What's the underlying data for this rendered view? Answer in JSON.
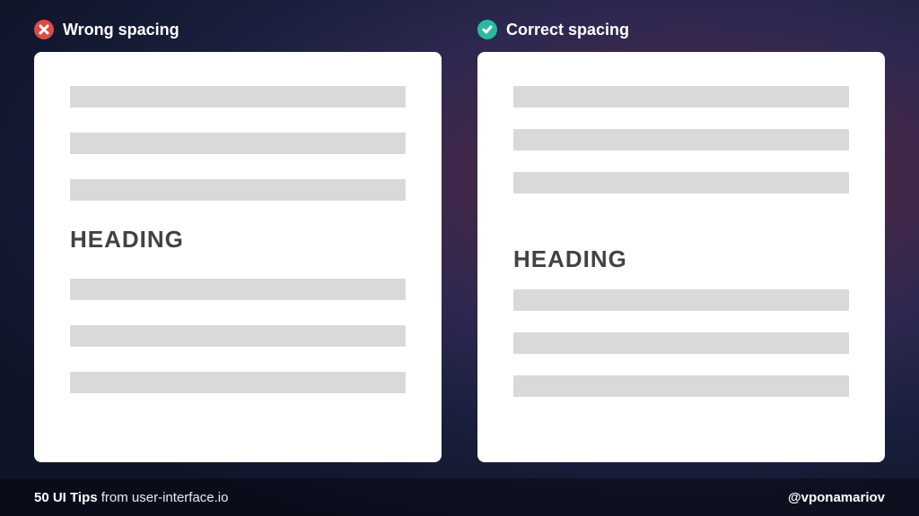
{
  "columns": {
    "wrong": {
      "title": "Wrong spacing",
      "heading": "HEADING"
    },
    "correct": {
      "title": "Correct spacing",
      "heading": "HEADING"
    }
  },
  "footer": {
    "bold": "50 UI Tips",
    "light": " from user-interface.io",
    "handle": "@vponamariov"
  }
}
